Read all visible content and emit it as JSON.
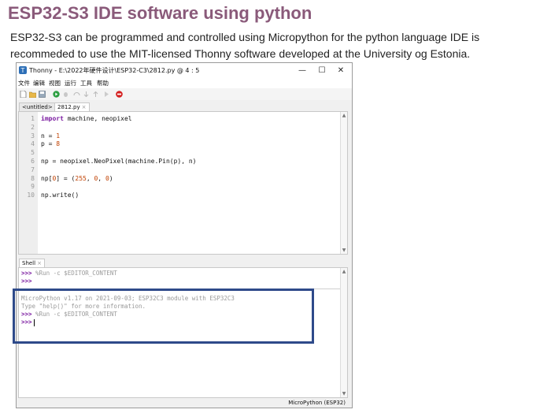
{
  "page": {
    "title": "ESP32-S3 IDE software using python",
    "intro_line1": "ESP32-S3 can be programmed and controlled using Micropython for the python language IDE is",
    "intro_line2": "recommeded to use the MIT-licensed Thonny software developed at the University og Estonia."
  },
  "window": {
    "title": "Thonny  -  E:\\2022年硬件设计\\ESP32-C3\\2812.py  @  4 : 5",
    "controls": {
      "minimize": "—",
      "maximize": "☐",
      "close": "✕"
    }
  },
  "menu": [
    "文件",
    "编辑",
    "视图",
    "运行",
    "工具",
    "帮助"
  ],
  "toolbar": {
    "icons": [
      "new-file-icon",
      "open-file-icon",
      "save-icon",
      "run-icon",
      "debug-icon",
      "step-over-icon",
      "step-into-icon",
      "step-out-icon",
      "resume-icon",
      "stop-icon"
    ],
    "stop_color": "#d42020",
    "run_color": "#2ea043"
  },
  "editor": {
    "tabs": [
      {
        "label": "<untitled>",
        "close": "×"
      },
      {
        "label": "2812.py",
        "close": "×"
      }
    ],
    "line_numbers": [
      "1",
      "2",
      "3",
      "4",
      "5",
      "6",
      "7",
      "8",
      "9",
      "10"
    ]
  },
  "shell": {
    "tab": {
      "label": "Shell",
      "close": "×"
    },
    "history": [
      {
        "prompt": ">>>",
        "text": " %Run -c $EDITOR_CONTENT"
      },
      {
        "prompt": ">>>",
        "text": ""
      }
    ],
    "banner1": "MicroPython v1.17 on 2021-09-03; ESP32C3 module with ESP32C3",
    "banner2": "Type \"help()\" for more information.",
    "run_prompt": ">>>",
    "run_text": " %Run -c $EDITOR_CONTENT",
    "last_prompt": ">>>"
  },
  "status": {
    "interpreter": "MicroPython (ESP32)"
  },
  "colors": {
    "heading": "#8a5a7a",
    "highlight_border": "#2e4a8a",
    "keyword": "#7a1aa0",
    "number": "#c04000"
  }
}
